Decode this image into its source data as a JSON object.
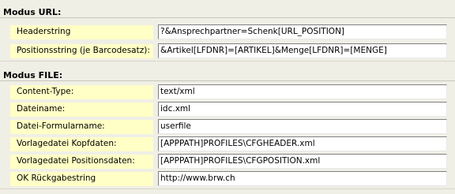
{
  "sections": {
    "url": {
      "header": "Modus URL:",
      "rows": [
        {
          "label": "Headerstring",
          "value": "?&Ansprechpartner=Schenk[URL_POSITION]"
        },
        {
          "label": "Positionsstring (je Barcodesatz):",
          "value": "&Artikel[LFDNR]=[ARTIKEL]&Menge[LFDNR]=[MENGE]"
        }
      ]
    },
    "file": {
      "header": "Modus FILE:",
      "rows": [
        {
          "label": "Content-Type:",
          "value": "text/xml"
        },
        {
          "label": "Dateiname:",
          "value": "idc.xml"
        },
        {
          "label": "Datei-Formularname:",
          "value": "userfile"
        },
        {
          "label": "Vorlagedatei Kopfdaten:",
          "value": "[APPPATH]PROFILES\\CFGHEADER.xml"
        },
        {
          "label": "Vorlagedatei Positionsdaten:",
          "value": "[APPPATH]PROFILES\\CFGPOSITION.xml"
        },
        {
          "label": "OK Rückgabestring",
          "value": "http://www.brw.ch"
        }
      ]
    }
  },
  "colors": {
    "background": "#f0efe6",
    "label_background": "#ffffc6",
    "field_background": "#ffffff"
  }
}
